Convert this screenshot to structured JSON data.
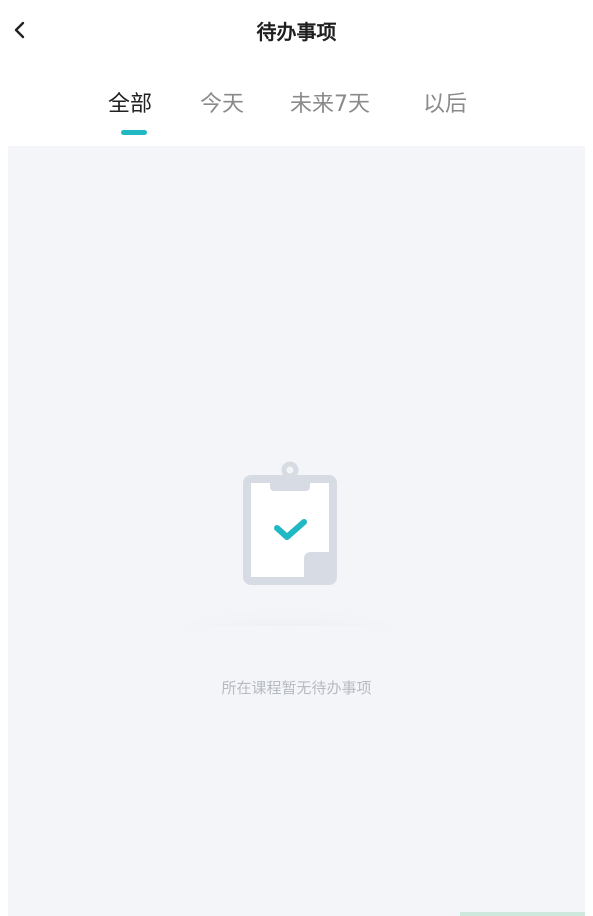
{
  "header": {
    "title": "待办事项",
    "back_icon": "chevron-left-icon"
  },
  "tabs": [
    {
      "label": "全部",
      "active": true
    },
    {
      "label": "今天",
      "active": false
    },
    {
      "label": "未来7天",
      "active": false
    },
    {
      "label": "以后",
      "active": false
    }
  ],
  "empty_state": {
    "icon": "clipboard-check-icon",
    "message": "所在课程暂无待办事项"
  },
  "colors": {
    "accent": "#1fb8c3",
    "content_background": "#f4f5f8",
    "tab_inactive": "#8a8a8a",
    "tab_active": "#222222",
    "empty_text": "#b6bac2"
  }
}
